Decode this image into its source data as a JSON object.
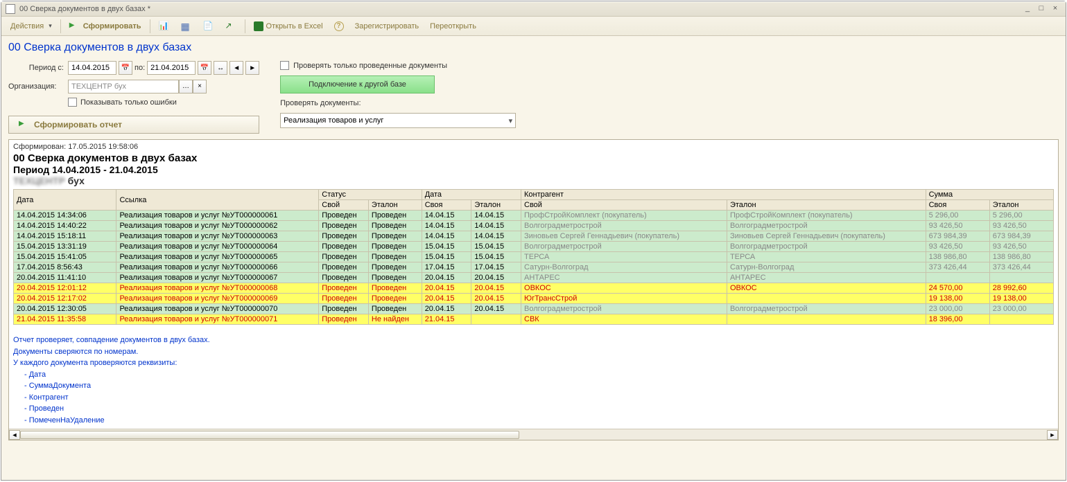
{
  "window_title": "00 Сверка документов в двух базах *",
  "toolbar": {
    "actions": "Действия",
    "form": "Сформировать",
    "open_excel": "Открыть в Excel",
    "register": "Зарегистрировать",
    "reopen": "Переоткрыть"
  },
  "page_title": "00 Сверка документов в двух базах",
  "params": {
    "period_from_label": "Период с:",
    "period_from": "14.04.2015",
    "period_to_label": "по:",
    "period_to": "21.04.2015",
    "org_label": "Организация:",
    "org_value_blur": "ТЕХЦЕНТР",
    "org_value_suffix": " бух",
    "show_errors_only": "Показывать только ошибки",
    "check_posted_only": "Проверять только проведенные документы",
    "connect_other_base": "Подключение к другой базе",
    "check_docs_label": "Проверять документы:",
    "doc_type": "Реализация товаров и услуг",
    "form_report_btn": "Сформировать отчет"
  },
  "report": {
    "stamp": "Сформирован: 17.05.2015 19:58:06",
    "title": "00 Сверка документов в двух базах",
    "period": "Период 14.04.2015 - 21.04.2015",
    "org_suffix": " бух",
    "headers": {
      "date": "Дата",
      "ref": "Ссылка",
      "status": "Статус",
      "own": "Свой",
      "etalon": "Эталон",
      "date2": "Дата",
      "own_f": "Своя",
      "counterparty": "Контрагент",
      "sum": "Сумма"
    },
    "rows": [
      {
        "cls": "ok",
        "date": "14.04.2015 14:34:06",
        "ref": "Реализация товаров и услуг №УТ000000061",
        "s1": "Проведен",
        "s2": "Проведен",
        "d1": "14.04.15",
        "d2": "14.04.15",
        "k1": "ПрофСтройКомплект (покупатель)",
        "k2": "ПрофСтройКомплект (покупатель)",
        "a1": "5 296,00",
        "a2": "5 296,00"
      },
      {
        "cls": "ok",
        "date": "14.04.2015 14:40:22",
        "ref": "Реализация товаров и услуг №УТ000000062",
        "s1": "Проведен",
        "s2": "Проведен",
        "d1": "14.04.15",
        "d2": "14.04.15",
        "k1": "Волгоградметрострой",
        "k2": "Волгоградметрострой",
        "a1": "93 426,50",
        "a2": "93 426,50"
      },
      {
        "cls": "ok",
        "date": "14.04.2015 15:18:11",
        "ref": "Реализация товаров и услуг №УТ000000063",
        "s1": "Проведен",
        "s2": "Проведен",
        "d1": "14.04.15",
        "d2": "14.04.15",
        "k1": "Зиновьев Сергей Геннадьевич (покупатель)",
        "k2": "Зиновьев Сергей Геннадьевич (покупатель)",
        "a1": "673 984,39",
        "a2": "673 984,39"
      },
      {
        "cls": "ok",
        "date": "15.04.2015 13:31:19",
        "ref": "Реализация товаров и услуг №УТ000000064",
        "s1": "Проведен",
        "s2": "Проведен",
        "d1": "15.04.15",
        "d2": "15.04.15",
        "k1": "Волгоградметрострой",
        "k2": "Волгоградметрострой",
        "a1": "93 426,50",
        "a2": "93 426,50"
      },
      {
        "cls": "ok",
        "date": "15.04.2015 15:41:05",
        "ref": "Реализация товаров и услуг №УТ000000065",
        "s1": "Проведен",
        "s2": "Проведен",
        "d1": "15.04.15",
        "d2": "15.04.15",
        "k1": "ТЕРСА",
        "k2": "ТЕРСА",
        "a1": "138 986,80",
        "a2": "138 986,80"
      },
      {
        "cls": "ok",
        "date": "17.04.2015 8:56:43",
        "ref": "Реализация товаров и услуг №УТ000000066",
        "s1": "Проведен",
        "s2": "Проведен",
        "d1": "17.04.15",
        "d2": "17.04.15",
        "k1": "Сатурн-Волгоград",
        "k2": "Сатурн-Волгоград",
        "a1": "373 426,44",
        "a2": "373 426,44"
      },
      {
        "cls": "ok",
        "date": "20.04.2015 11:41:10",
        "ref": "Реализация товаров и услуг №УТ000000067",
        "s1": "Проведен",
        "s2": "Проведен",
        "d1": "20.04.15",
        "d2": "20.04.15",
        "k1": "АНТАРЕС",
        "k2": "АНТАРЕС",
        "a1": "",
        "a2": ""
      },
      {
        "cls": "yl-red",
        "date": "20.04.2015 12:01:12",
        "ref": "Реализация товаров и услуг №УТ000000068",
        "s1": "Проведен",
        "s2": "Проведен",
        "d1": "20.04.15",
        "d2": "20.04.15",
        "k1": "ОВКОС",
        "k2": "ОВКОС",
        "a1": "24 570,00",
        "a2": "28 992,60"
      },
      {
        "cls": "yl-red",
        "date": "20.04.2015 12:17:02",
        "ref": "Реализация товаров и услуг №УТ000000069",
        "s1": "Проведен",
        "s2": "Проведен",
        "d1": "20.04.15",
        "d2": "20.04.15",
        "k1": "ЮгТрансСтрой",
        "k2": "",
        "a1": "19 138,00",
        "a2": "19 138,00"
      },
      {
        "cls": "ok",
        "date": "20.04.2015 12:30:05",
        "ref": "Реализация товаров и услуг №УТ000000070",
        "s1": "Проведен",
        "s2": "Проведен",
        "d1": "20.04.15",
        "d2": "20.04.15",
        "k1": "Волгоградметрострой",
        "k2": "Волгоградметрострой",
        "a1": "23 000,00",
        "a2": "23 000,00"
      },
      {
        "cls": "yl-red",
        "date": "21.04.2015 11:35:58",
        "ref": "Реализация товаров и услуг №УТ000000071",
        "s1": "Проведен",
        "s2": "Не найден",
        "d1": "21.04.15",
        "d2": "",
        "k1": "СВК",
        "k2": "",
        "a1": "18 396,00",
        "a2": ""
      }
    ],
    "notes": {
      "l1": "Отчет проверяет, совпадение документов в двух базах.",
      "l2": "Документы сверяются по номерам.",
      "l3": "У каждого документа проверяются реквизиты:",
      "i1": "- Дата",
      "i2": "- СуммаДокумента",
      "i3": "- Контрагент",
      "i4": "- Проведен",
      "i5": "- ПомеченНаУдаление"
    }
  }
}
